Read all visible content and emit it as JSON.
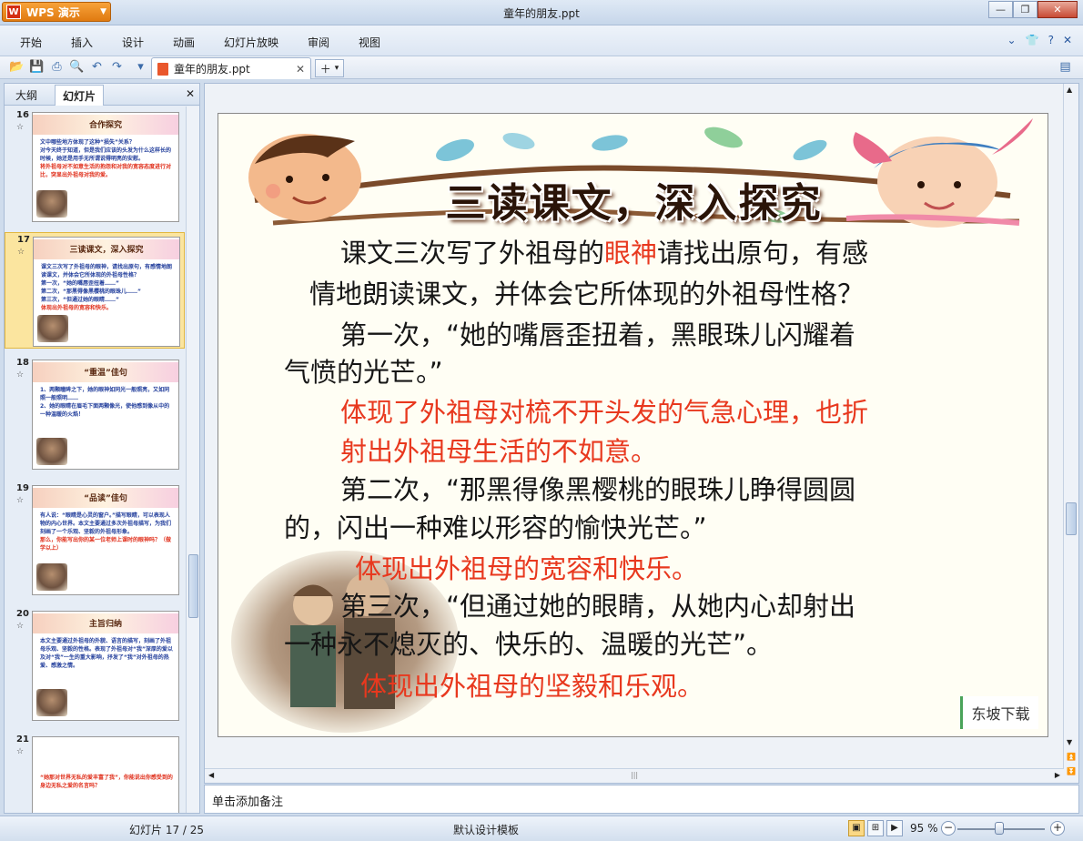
{
  "app": {
    "button_label": "WPS 演示",
    "window_title": "童年的朋友.ppt"
  },
  "menu": [
    "开始",
    "插入",
    "设计",
    "动画",
    "幻灯片放映",
    "审阅",
    "视图"
  ],
  "toolbar": {
    "document_tab": "童年的朋友.ppt"
  },
  "left_panel": {
    "tabs": [
      "大纲",
      "幻灯片"
    ],
    "selected_tab": "幻灯片",
    "thumbnails": [
      {
        "num": "16",
        "title": "合作探究",
        "lines": [
          "文中哪些地方体现了这种“损失”关系？",
          "对今天终于知道，但是我们应该的头发为什么这样长的时候，她还是用手无所谓说得明亮的安慰。"
        ],
        "red": "将外祖母对不如意生活的抱怨和对我的宽容态度进行对比，突显出外祖母对我的爱。"
      },
      {
        "num": "17",
        "title": "三读课文，深入探究",
        "lines": [
          "课文三次写了外祖母的眼神，请找出原句，有感情地朗读课文，并体会它所体现的外祖母性格？",
          "第一次，“她的嘴唇歪扭着……”",
          "第二次，“那黑得像黑樱桃的眼珠儿……”",
          "第三次，“但通过她的眼睛……”"
        ],
        "red": "体现出外祖母的宽容和快乐。"
      },
      {
        "num": "18",
        "title": "“重温”佳句",
        "lines": [
          "1、两颗瞳眸之下，她的眼神如同光一般照亮，又如同照一般照明……",
          "2、她的眼睛在眉毛下面两颗像光，使他感到像从中的一种温暖的火焰！"
        ],
        "red": ""
      },
      {
        "num": "19",
        "title": "“品读”佳句",
        "lines": [
          "有人说：“眼睛是心灵的窗户。”描写眼睛，可以表现人物的内心世界。本文主要通过多次外祖母描写，为我们刻画了一个乐观、坚毅的外祖母形象。"
        ],
        "red": "那么，你能写出你的某一位老师上课时的眼神吗？（做学以上）"
      },
      {
        "num": "20",
        "title": "主旨归纳",
        "lines": [
          "本文主要通过外祖母的外貌、语言的描写，刻画了外祖母乐观、坚毅的性格。表现了外祖母对“我”深厚的爱以及对“我”一生的重大影响，抒发了“我”对外祖母的热爱、感激之情。"
        ],
        "red": ""
      },
      {
        "num": "21",
        "title": "",
        "lines": [],
        "red": "“她那对世界无私的爱丰富了我”，你能说出你感受到的身边无私之爱的名言吗？"
      }
    ]
  },
  "slide": {
    "title": "三读课文，深入探究",
    "lines": [
      {
        "pre": "课文三次写了外祖母的",
        "hl": "眼神",
        "post": "请找出原句，有感"
      },
      {
        "pre": "情地朗读课文，并体会它所体现的外祖母性格？",
        "hl": "",
        "post": ""
      },
      {
        "pre": "第一次，“她的嘴唇歪扭着，黑眼珠儿闪耀着",
        "hl": "",
        "post": ""
      },
      {
        "pre": "气愤的光芒。”",
        "hl": "",
        "post": ""
      },
      {
        "pre": "第二次，“那黑得像黑樱桃的眼珠儿睁得圆圆",
        "hl": "",
        "post": ""
      },
      {
        "pre": "的，闪出一种难以形容的愉快光芒。”",
        "hl": "",
        "post": ""
      },
      {
        "pre": "第三次，“但通过她的眼睛，从她内心却射出",
        "hl": "",
        "post": ""
      },
      {
        "pre": "一种永不熄灭的、快乐的、温暖的光芒”。",
        "hl": "",
        "post": ""
      }
    ],
    "red_lines": [
      "体现了外祖母对梳不开头发的气急心理，也折",
      "射出外祖母生活的不如意。",
      "体现出外祖母的宽容和快乐。",
      "体现出外祖母的坚毅和乐观。"
    ],
    "watermark": "东坡下载",
    "colors": {
      "highlight": "#e8381e",
      "body": "#161616"
    }
  },
  "notes": {
    "placeholder": "单击添加备注"
  },
  "status": {
    "slide_counter": "幻灯片 17 / 25",
    "template": "默认设计模板",
    "zoom": "95 %",
    "zoom_level": 0.95
  }
}
